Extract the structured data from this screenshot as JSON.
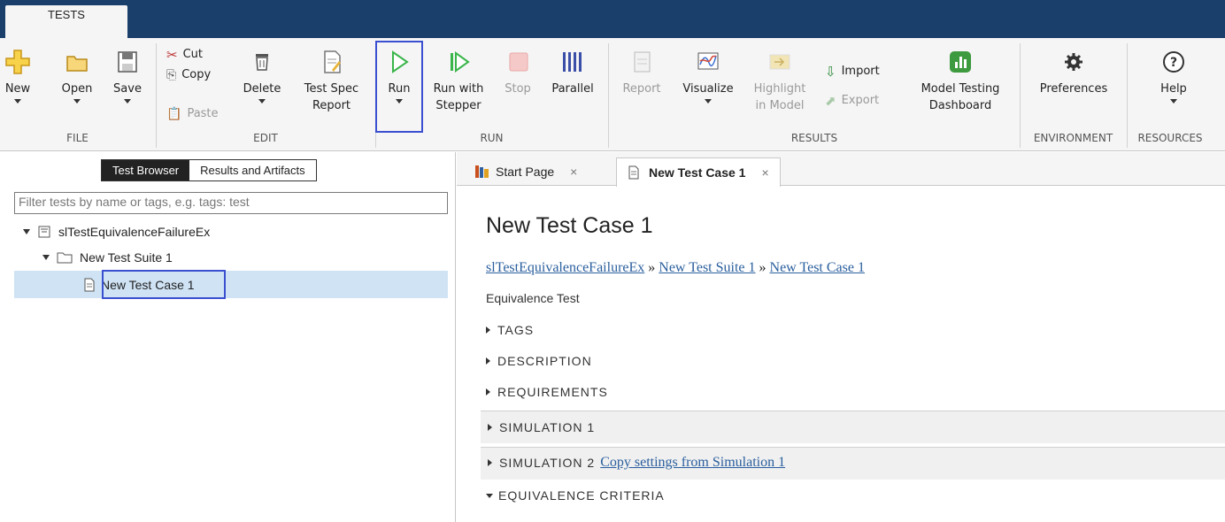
{
  "toolstrip": {
    "tab_label": "TESTS"
  },
  "ribbon": {
    "file": {
      "group_label": "FILE",
      "new_label": "New",
      "open_label": "Open",
      "save_label": "Save"
    },
    "edit": {
      "group_label": "EDIT",
      "cut_label": "Cut",
      "copy_label": "Copy",
      "paste_label": "Paste",
      "delete_label": "Delete",
      "test_spec_report_line1": "Test Spec",
      "test_spec_report_line2": "Report"
    },
    "run": {
      "group_label": "RUN",
      "run_label": "Run",
      "run_with_stepper_line1": "Run with",
      "run_with_stepper_line2": "Stepper",
      "stop_label": "Stop",
      "parallel_label": "Parallel"
    },
    "results": {
      "group_label": "RESULTS",
      "report_label": "Report",
      "visualize_label": "Visualize",
      "highlight_line1": "Highlight",
      "highlight_line2": "in Model",
      "import_label": "Import",
      "export_label": "Export",
      "model_testing_line1": "Model Testing",
      "model_testing_line2": "Dashboard"
    },
    "environment": {
      "group_label": "ENVIRONMENT",
      "preferences_label": "Preferences"
    },
    "resources": {
      "group_label": "RESOURCES",
      "help_label": "Help"
    }
  },
  "left_panel": {
    "toggle_active": "Test Browser",
    "toggle_inactive": "Results and Artifacts",
    "filter_placeholder": "Filter tests by name or tags, e.g. tags: test",
    "tree": {
      "file_label": "slTestEquivalenceFailureEx",
      "suite_label": "New Test Suite 1",
      "case_label": "New Test Case 1"
    }
  },
  "doc_tabs": {
    "start_page": "Start Page",
    "test_case": "New Test Case 1",
    "close_glyph": "×"
  },
  "test_case": {
    "title": "New Test Case 1",
    "breadcrumb": {
      "file": "slTestEquivalenceFailureEx",
      "sep": "»",
      "suite": "New Test Suite 1",
      "case": "New Test Case 1"
    },
    "type": "Equivalence Test",
    "sections": {
      "tags": "TAGS",
      "description": "DESCRIPTION",
      "requirements": "REQUIREMENTS",
      "simulation1": "SIMULATION 1",
      "simulation2": "SIMULATION 2",
      "copy_settings_link": "Copy settings from Simulation 1",
      "equivalence_criteria": "EQUIVALENCE CRITERIA"
    }
  },
  "colors": {
    "toolstrip_bg": "#1b3f6b",
    "highlight_border": "#3b4fd1",
    "selection_bg": "#cfe3f5",
    "link": "#2a5f9e"
  }
}
